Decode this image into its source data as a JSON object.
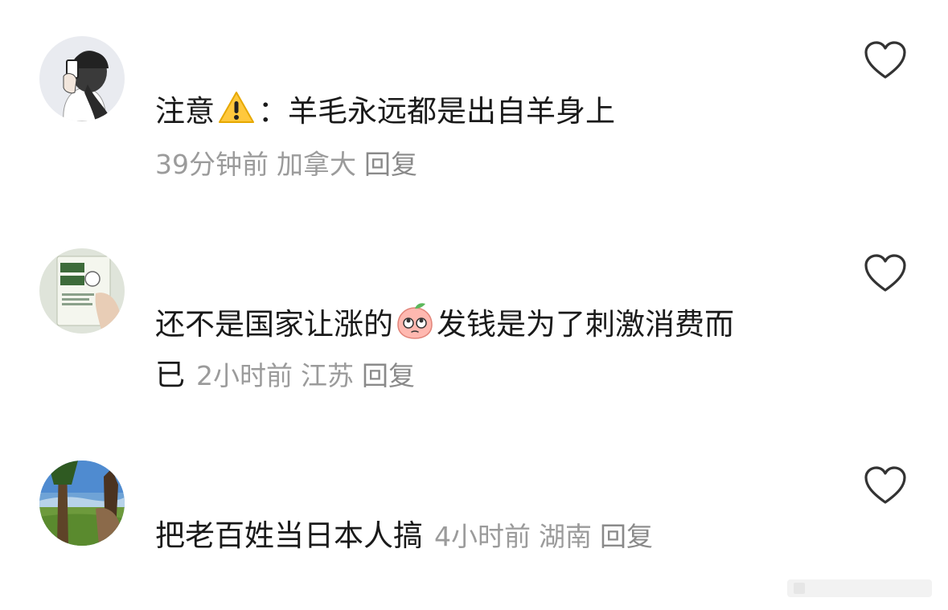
{
  "comments": [
    {
      "text_before": "注意",
      "text_after": "：羊毛永远都是出自羊身上",
      "time": "39分钟前",
      "location": "加拿大",
      "reply": "回复",
      "avatar_icon": "woman-in-beanie-avatar",
      "inline_emoji": "warning-icon"
    },
    {
      "text_before": "还不是国家让涨的",
      "text_after": "发钱是为了刺激消费而",
      "text_line2": "已",
      "time": "2小时前",
      "location": "江苏",
      "reply": "回复",
      "avatar_icon": "book-cover-avatar",
      "inline_emoji": "peach-rolling-eyes-emoji"
    },
    {
      "text": "把老百姓当日本人搞",
      "time": "4小时前",
      "location": "湖南",
      "reply": "回复",
      "avatar_icon": "forest-landscape-avatar"
    }
  ],
  "colors": {
    "text": "#1a1a1a",
    "meta": "#9b9b9b",
    "icon_stroke": "#333333"
  }
}
